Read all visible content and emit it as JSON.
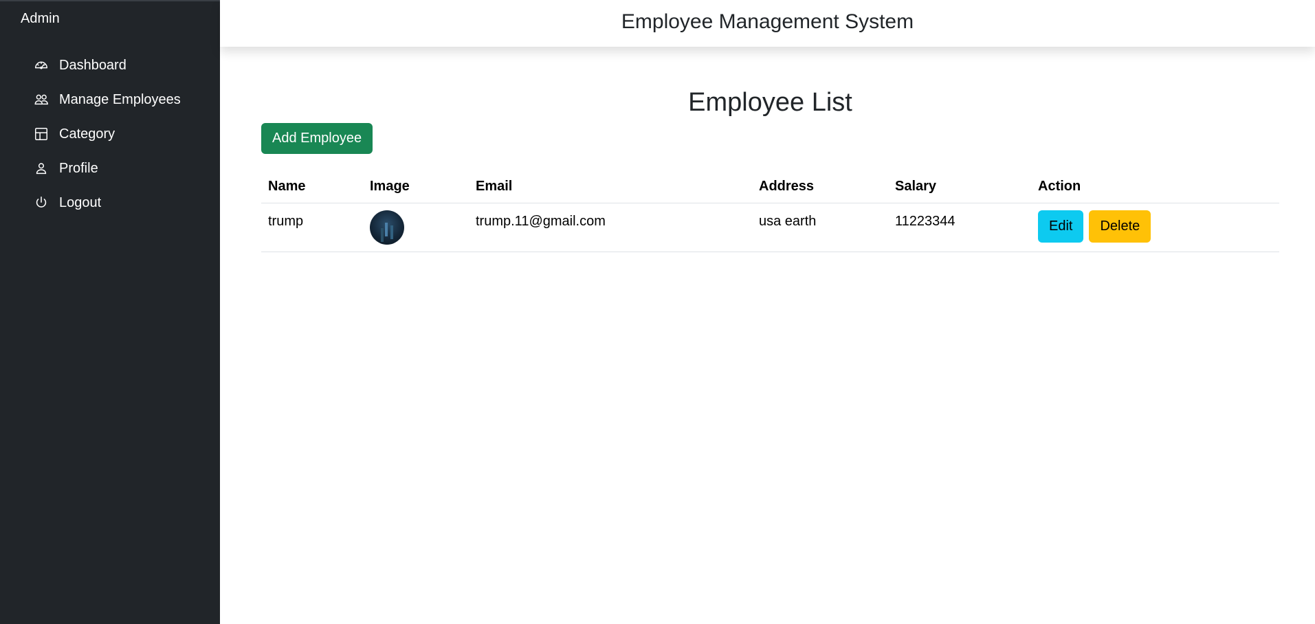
{
  "sidebar": {
    "brand": "Admin",
    "items": [
      {
        "label": "Dashboard",
        "icon": "speedometer-icon"
      },
      {
        "label": "Manage Employees",
        "icon": "people-icon"
      },
      {
        "label": "Category",
        "icon": "columns-icon"
      },
      {
        "label": "Profile",
        "icon": "person-icon"
      },
      {
        "label": "Logout",
        "icon": "power-icon"
      }
    ]
  },
  "header": {
    "title": "Employee Management System"
  },
  "main": {
    "title": "Employee List",
    "add_button": "Add Employee",
    "table": {
      "columns": [
        "Name",
        "Image",
        "Email",
        "Address",
        "Salary",
        "Action"
      ],
      "rows": [
        {
          "name": "trump",
          "email": "trump.11@gmail.com",
          "address": "usa earth",
          "salary": "11223344",
          "edit_label": "Edit",
          "delete_label": "Delete"
        }
      ]
    }
  },
  "colors": {
    "sidebar_bg": "#212529",
    "add_button": "#198754",
    "edit_button": "#0dcaf0",
    "delete_button": "#ffc107"
  }
}
